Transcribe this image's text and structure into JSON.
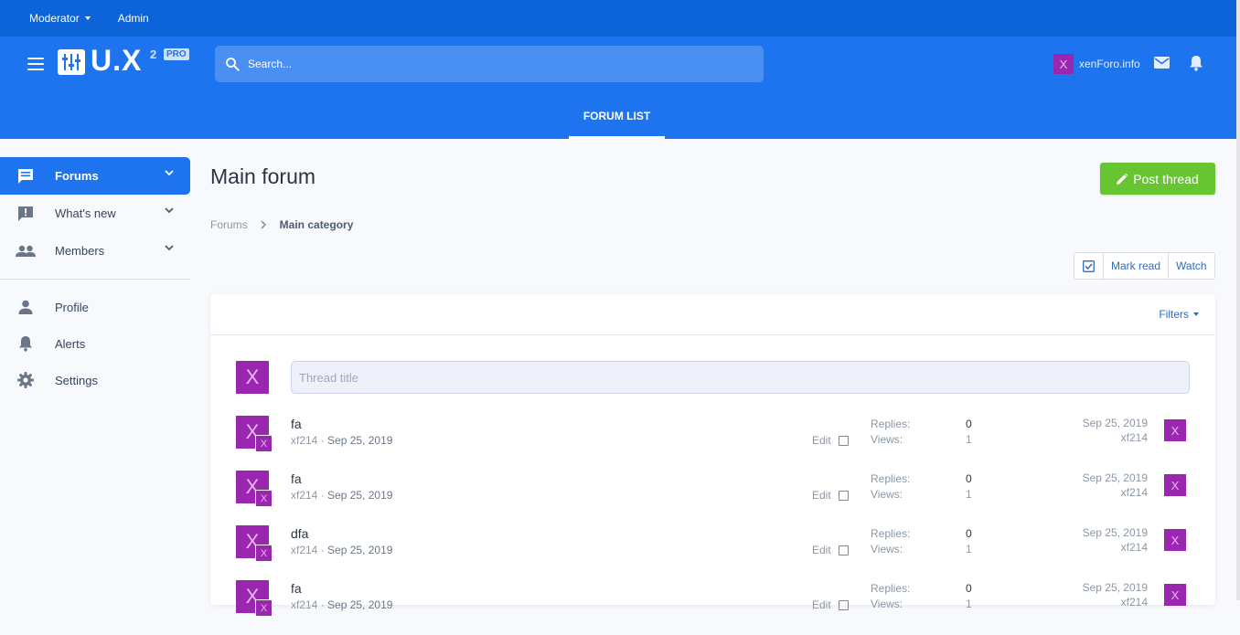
{
  "staff_bar": {
    "moderator": "Moderator",
    "admin": "Admin"
  },
  "header": {
    "logo_text": "U.X",
    "logo_sup": "2",
    "logo_badge": "PRO",
    "search_placeholder": "Search...",
    "user_avatar_letter": "X",
    "user_name": "xenForo.info",
    "nav_tab": "FORUM LIST"
  },
  "sidebar": {
    "primary": [
      {
        "label": "Forums",
        "active": true
      },
      {
        "label": "What's new",
        "active": false
      },
      {
        "label": "Members",
        "active": false
      }
    ],
    "secondary": [
      {
        "label": "Profile"
      },
      {
        "label": "Alerts"
      },
      {
        "label": "Settings"
      }
    ]
  },
  "main": {
    "title": "Main forum",
    "post_thread": "Post thread",
    "breadcrumb": [
      "Forums",
      "Main category"
    ],
    "actions": {
      "mark_read": "Mark read",
      "watch": "Watch"
    },
    "filters": "Filters",
    "quick_thread_placeholder": "Thread title",
    "quick_avatar": "X"
  },
  "threads": [
    {
      "title": "fa",
      "author": "xf214",
      "date": "Sep 25, 2019",
      "edit": "Edit",
      "replies_label": "Replies:",
      "views_label": "Views:",
      "replies": "0",
      "views": "1",
      "last_date": "Sep 25, 2019",
      "last_user": "xf214",
      "avatar": "X",
      "avatar_mini": "X"
    },
    {
      "title": "fa",
      "author": "xf214",
      "date": "Sep 25, 2019",
      "edit": "Edit",
      "replies_label": "Replies:",
      "views_label": "Views:",
      "replies": "0",
      "views": "1",
      "last_date": "Sep 25, 2019",
      "last_user": "xf214",
      "avatar": "X",
      "avatar_mini": "X"
    },
    {
      "title": "dfa",
      "author": "xf214",
      "date": "Sep 25, 2019",
      "edit": "Edit",
      "replies_label": "Replies:",
      "views_label": "Views:",
      "replies": "0",
      "views": "1",
      "last_date": "Sep 25, 2019",
      "last_user": "xf214",
      "avatar": "X",
      "avatar_mini": "X"
    },
    {
      "title": "fa",
      "author": "xf214",
      "date": "Sep 25, 2019",
      "edit": "Edit",
      "replies_label": "Replies:",
      "views_label": "Views:",
      "replies": "0",
      "views": "1",
      "last_date": "Sep 25, 2019",
      "last_user": "xf214",
      "avatar": "X",
      "avatar_mini": "X"
    }
  ],
  "colors": {
    "staff_bar": "#0d63d8",
    "header": "#1e74ee",
    "accent_green": "#66c531",
    "avatar": "#9b27b0"
  }
}
